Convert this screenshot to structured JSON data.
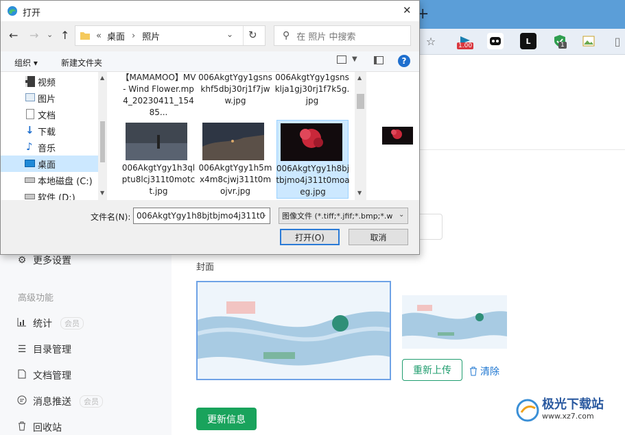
{
  "browser": {
    "new_tab": "+",
    "extensions": [
      {
        "icon": "star-add-icon",
        "badge": ""
      },
      {
        "icon": "flag-icon",
        "badge": "1.00"
      },
      {
        "icon": "robot-icon",
        "badge": ""
      },
      {
        "icon": "l-icon",
        "badge": ""
      },
      {
        "icon": "shield-check-icon",
        "badge": "1"
      },
      {
        "icon": "image-icon",
        "badge": ""
      },
      {
        "icon": "clipboard-icon",
        "badge": ""
      }
    ]
  },
  "sidebar": {
    "more_settings": "更多设置",
    "advanced_heading": "高级功能",
    "items": [
      {
        "label": "统计",
        "tag": "会员"
      },
      {
        "label": "目录管理",
        "tag": ""
      },
      {
        "label": "文档管理",
        "tag": ""
      },
      {
        "label": "消息推送",
        "tag": "会员"
      },
      {
        "label": "回收站",
        "tag": ""
      }
    ]
  },
  "main": {
    "cover_label": "封面",
    "reupload": "重新上传",
    "clear": "清除",
    "update_info": "更新信息"
  },
  "watermark": {
    "brand": "极光下载站",
    "url": "www.xz7.com"
  },
  "dialog": {
    "title": "打开",
    "close": "✕",
    "breadcrumb": [
      "«",
      "桌面",
      "›",
      "照片"
    ],
    "search_placeholder": "在 照片 中搜索",
    "organize": "组织 ▾",
    "new_folder": "新建文件夹",
    "help": "?",
    "nav_items": [
      "视频",
      "图片",
      "文档",
      "下载",
      "音乐",
      "桌面",
      "本地磁盘 (C:)",
      "软件 (D:)"
    ],
    "nav_selected": 5,
    "files_top": [
      "【MAMAMOO】MV- Wind Flower.mp4_20230411_15485...",
      "006AkgtYgy1gsnskhf5dbj30rj1f7jww.jpg",
      "006AkgtYgy1gsnsklja1gj30rj1f7k5g.jpg"
    ],
    "files_bottom": [
      "006AkgtYgy1h3qlptu8lcj311t0motct.jpg",
      "006AkgtYgy1h5mx4m8cjwj311t0mojvr.jpg",
      "006AkgtYgy1h8bjtbjmo4j311t0moaeg.jpg"
    ],
    "selected_file": 2,
    "filename_label": "文件名(N):",
    "filename_value": "006AkgtYgy1h8bjtbjmo4j311t0",
    "filetype": "图像文件 (*.tiff;*.jfif;*.bmp;*.w",
    "open": "打开(O)",
    "cancel": "取消"
  },
  "colors": {
    "accent_green": "#19a35c",
    "selection_blue": "#cce8ff",
    "browser_blue": "#5b9ed8"
  }
}
